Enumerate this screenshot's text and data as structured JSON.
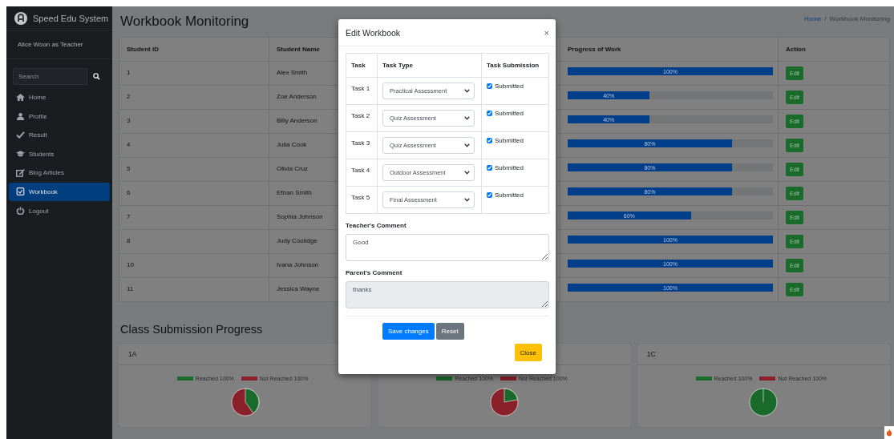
{
  "sidebar": {
    "brand": "Speed Edu System",
    "user": "Alice Woon as Teacher",
    "search": {
      "placeholder": "Search"
    },
    "items": [
      {
        "label": "Home",
        "kind": "home",
        "selected": false
      },
      {
        "label": "Profile",
        "kind": "profile",
        "selected": false
      },
      {
        "label": "Result",
        "kind": "result",
        "selected": false
      },
      {
        "label": "Students",
        "kind": "students",
        "selected": false
      },
      {
        "label": "Blog Articles",
        "kind": "blog",
        "selected": false
      },
      {
        "label": "Workbook",
        "kind": "workbook",
        "selected": true
      },
      {
        "label": "Logout",
        "kind": "logout",
        "selected": false
      }
    ]
  },
  "page": {
    "title": "Workbook Monitoring",
    "breadcrumb": [
      {
        "label": "Home",
        "kind": "link"
      },
      {
        "label": "Workbook Monitoring",
        "kind": "current"
      }
    ],
    "breadcrumb_separator": "/"
  },
  "table": {
    "columns": [
      "Student ID",
      "Student Name",
      "Progress of Work",
      "Action"
    ],
    "rows": [
      {
        "id": "1",
        "name": "Alex Smith",
        "progress": {
          "level": 1,
          "label": "100%"
        },
        "action": "Edit"
      },
      {
        "id": "2",
        "name": "Zoe Anderson",
        "progress": {
          "level": 0.4,
          "label": "40%"
        },
        "action": "Edit"
      },
      {
        "id": "3",
        "name": "Billy Anderson",
        "progress": {
          "level": 0.4,
          "label": "40%"
        },
        "action": "Edit"
      },
      {
        "id": "4",
        "name": "Julia Cook",
        "progress": {
          "level": 0.8,
          "label": "80%"
        },
        "action": "Edit"
      },
      {
        "id": "5",
        "name": "Olivia Cruz",
        "progress": {
          "level": 0.8,
          "label": "80%"
        },
        "action": "Edit"
      },
      {
        "id": "6",
        "name": "Ethan Smith",
        "progress": {
          "level": 0.8,
          "label": "80%"
        },
        "action": "Edit"
      },
      {
        "id": "7",
        "name": "Sophia Johnson",
        "progress": {
          "level": 0.6,
          "label": "60%"
        },
        "action": "Edit"
      },
      {
        "id": "8",
        "name": "Judy Coolidge",
        "progress": {
          "level": 1,
          "label": "100%"
        },
        "action": "Edit"
      },
      {
        "id": "10",
        "name": "Ivana Johnson",
        "progress": {
          "level": 1,
          "label": "100%"
        },
        "action": "Edit"
      },
      {
        "id": "11",
        "name": "Jessica Wayne",
        "progress": {
          "level": 1,
          "label": "100%"
        },
        "action": "Edit"
      }
    ]
  },
  "progress_section": {
    "title": "Class Submission Progress",
    "cards": [
      {
        "title": "1A",
        "legend": [
          {
            "label": "Reached 100%",
            "color": "#1a6a2c"
          },
          {
            "label": "Not Reached 100%",
            "color": "#8a2029"
          }
        ]
      },
      {
        "legend": [
          {
            "label": "Reached 100%",
            "color": "#1a6a2c"
          },
          {
            "label": "Not Reached 100%",
            "color": "#8a2029"
          }
        ]
      },
      {
        "title": "1C",
        "legend": [
          {
            "label": "Reached 100%",
            "color": "#1a6a2c"
          },
          {
            "label": "Not Reached 100%",
            "color": "#8a2029"
          }
        ]
      }
    ]
  },
  "modal": {
    "title": "Edit Workbook",
    "close": "×",
    "columns": [
      "Task",
      "Task Type",
      "Task Submission"
    ],
    "tasks": [
      {
        "task": "Task 1",
        "type": "Practical Assessment",
        "submitted": true,
        "submission_label": "Submitted"
      },
      {
        "task": "Task 2",
        "type": "Quiz Assessment",
        "submitted": true,
        "submission_label": "Submitted"
      },
      {
        "task": "Task 3",
        "type": "Quiz Assessment",
        "submitted": true,
        "submission_label": "Submitted"
      },
      {
        "task": "Task 4",
        "type": "Outdoor Assessment",
        "submitted": true,
        "submission_label": "Submitted"
      },
      {
        "task": "Task 5",
        "type": "Final Assessment",
        "submitted": true,
        "submission_label": "Submitted"
      }
    ],
    "teacher_comment": {
      "label": "Teacher's Comment",
      "value": "Good",
      "disabled": false
    },
    "parent_comment": {
      "label": "Parent's Comment",
      "value": "thanks",
      "disabled": true
    },
    "buttons": [
      {
        "label": "Save changes",
        "kind": "primary"
      },
      {
        "label": "Reset",
        "kind": "secondary"
      }
    ],
    "close_button": "Close"
  }
}
